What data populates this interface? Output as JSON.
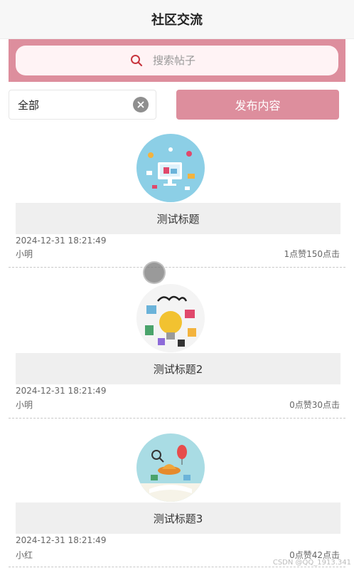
{
  "header": {
    "title": "社区交流"
  },
  "search": {
    "placeholder": "搜索帖子"
  },
  "filter": {
    "selected": "全部"
  },
  "publish_button": {
    "label": "发布内容"
  },
  "posts": [
    {
      "title": "测试标题",
      "time": "2024-12-31 18:21:49",
      "author": "小明",
      "stats": "1点赞150点击"
    },
    {
      "title": "测试标题2",
      "time": "2024-12-31 18:21:49",
      "author": "小明",
      "stats": "0点赞30点击"
    },
    {
      "title": "测试标题3",
      "time": "2024-12-31 18:21:49",
      "author": "小红",
      "stats": "0点赞42点击"
    }
  ],
  "watermark": "CSDN @QQ_1913.341",
  "colors": {
    "accent": "#dd8e9d",
    "search_bg": "#fff3f5",
    "title_bar_bg": "#efefef",
    "search_icon": "#c8363f"
  },
  "icons": [
    "search-icon",
    "clear-icon"
  ]
}
